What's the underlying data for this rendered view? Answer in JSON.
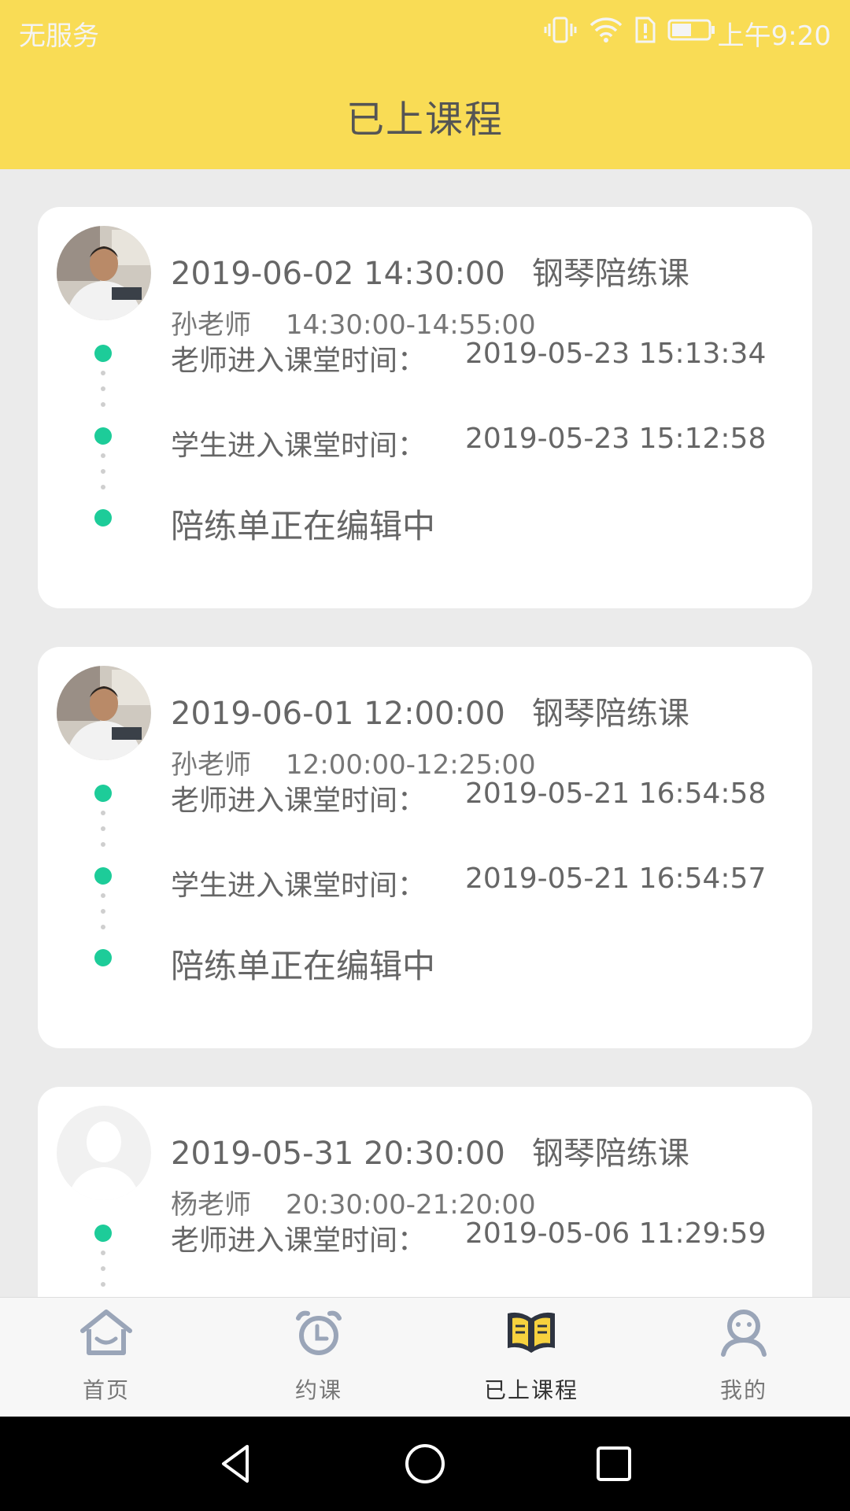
{
  "status_bar": {
    "carrier": "无服务",
    "time": "上午9:20",
    "icons": [
      "vibrate-icon",
      "wifi-icon",
      "sim-alert-icon",
      "battery-icon"
    ]
  },
  "header": {
    "title": "已上课程"
  },
  "courses": [
    {
      "avatar": "teacher-photo",
      "datetime": "2019-06-02 14:30:00",
      "course_type": "钢琴陪练课",
      "teacher": "孙老师",
      "time_range": "14:30:00-14:55:00",
      "teacher_enter_label": "老师进入课堂时间：",
      "teacher_enter_time": "2019-05-23 15:13:34",
      "student_enter_label": "学生进入课堂时间：",
      "student_enter_time": "2019-05-23 15:12:58",
      "status": "陪练单正在编辑中"
    },
    {
      "avatar": "teacher-photo",
      "datetime": "2019-06-01 12:00:00",
      "course_type": "钢琴陪练课",
      "teacher": "孙老师",
      "time_range": "12:00:00-12:25:00",
      "teacher_enter_label": "老师进入课堂时间：",
      "teacher_enter_time": "2019-05-21 16:54:58",
      "student_enter_label": "学生进入课堂时间：",
      "student_enter_time": "2019-05-21 16:54:57",
      "status": "陪练单正在编辑中"
    },
    {
      "avatar": "default-avatar",
      "datetime": "2019-05-31 20:30:00",
      "course_type": "钢琴陪练课",
      "teacher": "杨老师",
      "time_range": "20:30:00-21:20:00",
      "teacher_enter_label": "老师进入课堂时间：",
      "teacher_enter_time": "2019-05-06 11:29:59"
    }
  ],
  "tabbar": {
    "items": [
      {
        "label": "首页",
        "icon": "home-icon",
        "active": false
      },
      {
        "label": "约课",
        "icon": "alarm-clock-icon",
        "active": false
      },
      {
        "label": "已上课程",
        "icon": "open-book-icon",
        "active": true
      },
      {
        "label": "我的",
        "icon": "user-icon",
        "active": false
      }
    ]
  },
  "colors": {
    "header_yellow": "#f9dc55",
    "timeline_green": "#1dcc99",
    "active_book_yellow": "#f7d23e",
    "background": "#ebebeb"
  },
  "system_nav": [
    "back-icon",
    "home-circle-icon",
    "recents-icon"
  ]
}
